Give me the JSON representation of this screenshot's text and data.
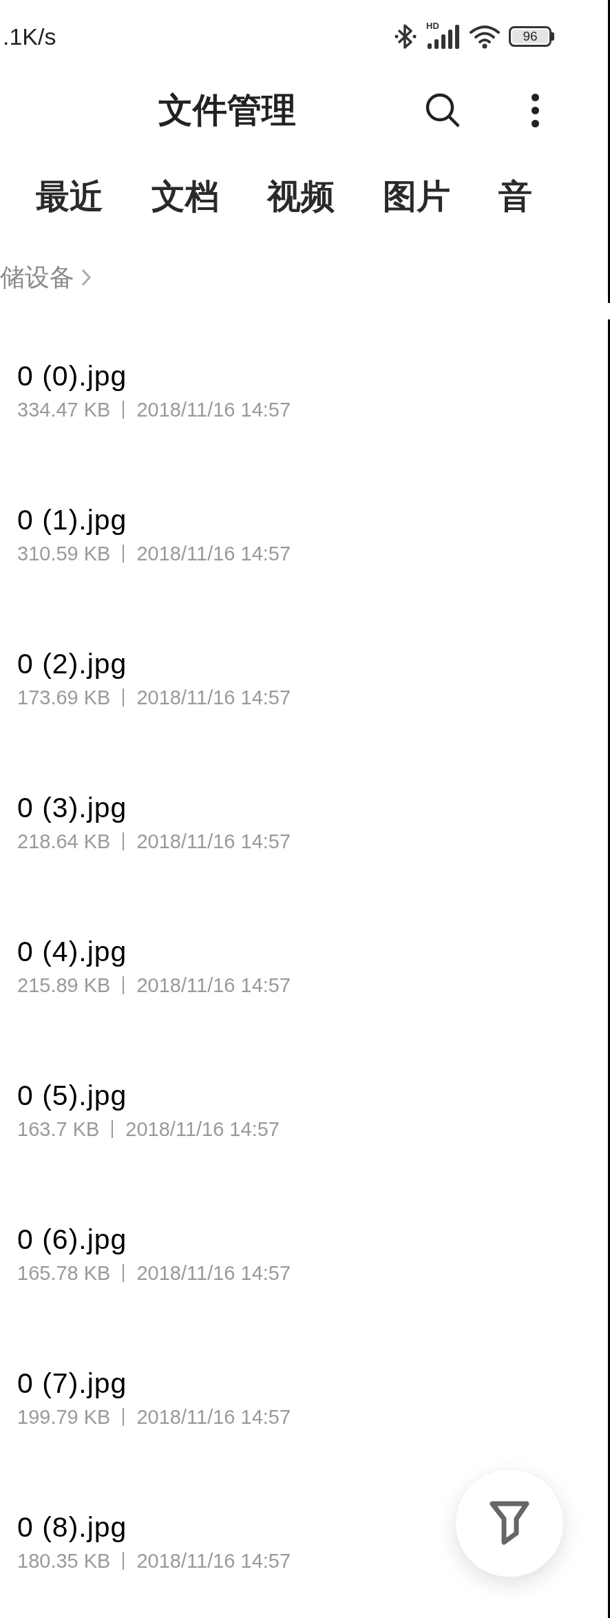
{
  "status_bar": {
    "speed": ".1K/s",
    "network": "HD",
    "battery": "96"
  },
  "header": {
    "title": "文件管理"
  },
  "tabs": [
    {
      "label": "最近"
    },
    {
      "label": "文档"
    },
    {
      "label": "视频"
    },
    {
      "label": "图片"
    },
    {
      "label": "音"
    }
  ],
  "breadcrumb": [
    "储设备"
  ],
  "files": [
    {
      "name": "0 (0).jpg",
      "size": "334.47 KB",
      "date": "2018/11/16 14:57"
    },
    {
      "name": "0 (1).jpg",
      "size": "310.59 KB",
      "date": "2018/11/16 14:57"
    },
    {
      "name": "0 (2).jpg",
      "size": "173.69 KB",
      "date": "2018/11/16 14:57"
    },
    {
      "name": "0 (3).jpg",
      "size": "218.64 KB",
      "date": "2018/11/16 14:57"
    },
    {
      "name": "0 (4).jpg",
      "size": "215.89 KB",
      "date": "2018/11/16 14:57"
    },
    {
      "name": "0 (5).jpg",
      "size": "163.7 KB",
      "date": "2018/11/16 14:57"
    },
    {
      "name": "0 (6).jpg",
      "size": "165.78 KB",
      "date": "2018/11/16 14:57"
    },
    {
      "name": "0 (7).jpg",
      "size": "199.79 KB",
      "date": "2018/11/16 14:57"
    },
    {
      "name": "0 (8).jpg",
      "size": "180.35 KB",
      "date": "2018/11/16 14:57"
    }
  ]
}
